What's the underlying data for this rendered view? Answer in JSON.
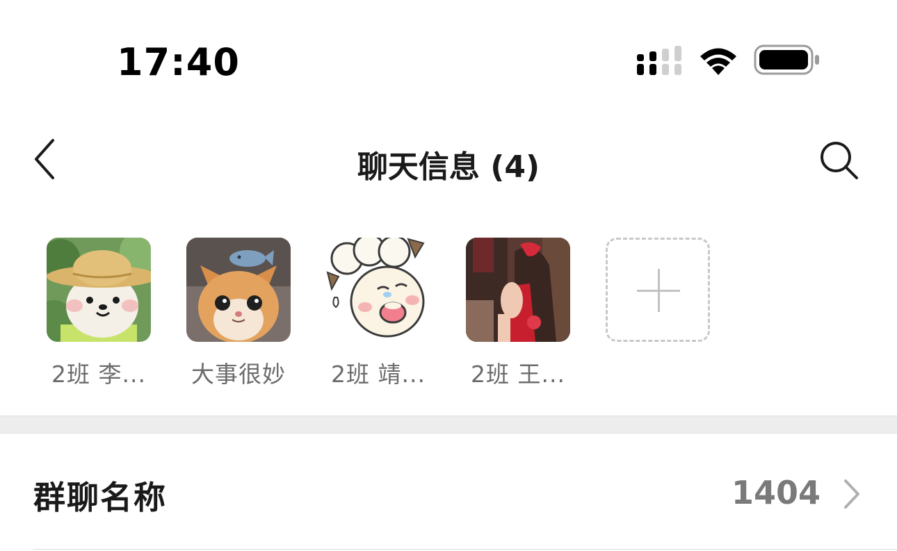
{
  "status_bar": {
    "time": "17:40",
    "signal_icon": "cellular-signal-icon",
    "wifi_icon": "wifi-icon",
    "battery_icon": "battery-icon"
  },
  "nav": {
    "title": "聊天信息 (4)",
    "back_icon": "chevron-left-icon",
    "search_icon": "search-icon"
  },
  "members": [
    {
      "name": "2班 李...",
      "avatar": "bear-straw-hat-avatar"
    },
    {
      "name": "大事很妙",
      "avatar": "orange-cat-avatar"
    },
    {
      "name": "2班 靖...",
      "avatar": "cartoon-sheep-avatar"
    },
    {
      "name": "2班 王...",
      "avatar": "girl-red-dress-avatar"
    }
  ],
  "add_member_icon": "plus-icon",
  "group_name_row": {
    "label": "群聊名称",
    "value": "1404",
    "chevron_icon": "chevron-right-icon"
  }
}
